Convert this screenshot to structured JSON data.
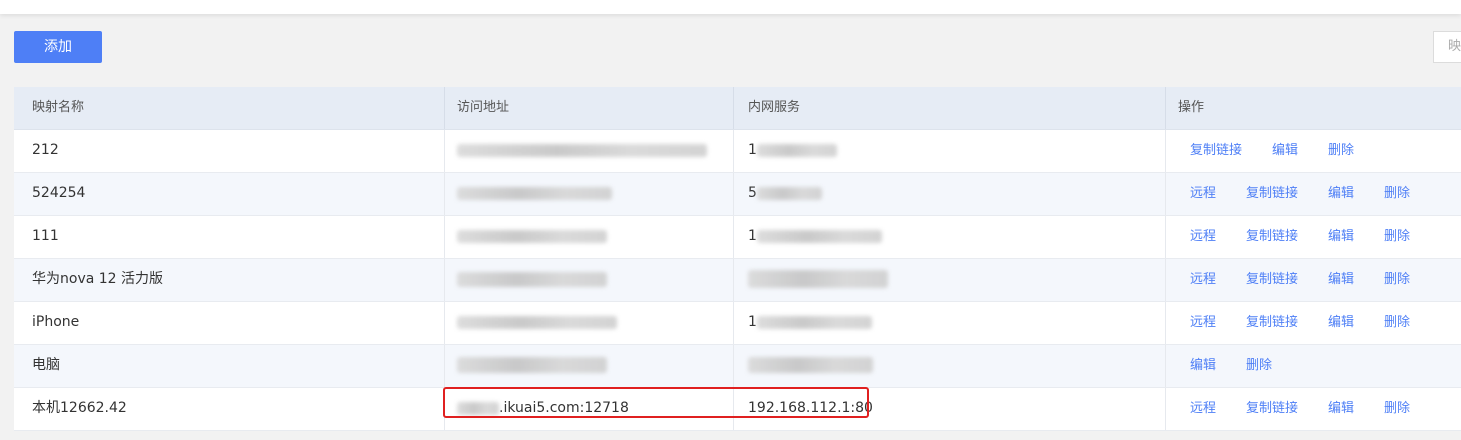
{
  "toolbar": {
    "add_label": "添加",
    "search_placeholder": "映"
  },
  "table": {
    "headers": [
      "映射名称",
      "访问地址",
      "内网服务",
      "操作"
    ],
    "rows": [
      {
        "name": "212",
        "address": "",
        "service": "1",
        "actions": [
          "复制链接",
          "编辑",
          "删除"
        ]
      },
      {
        "name": "524254",
        "address": "",
        "service": "5",
        "actions": [
          "远程",
          "复制链接",
          "编辑",
          "删除"
        ]
      },
      {
        "name": "111",
        "address": "",
        "service": "1",
        "actions": [
          "远程",
          "复制链接",
          "编辑",
          "删除"
        ]
      },
      {
        "name": "华为nova 12 活力版",
        "address": "",
        "service": "",
        "actions": [
          "远程",
          "复制链接",
          "编辑",
          "删除"
        ]
      },
      {
        "name": "iPhone",
        "address": "",
        "service": "1",
        "actions": [
          "远程",
          "复制链接",
          "编辑",
          "删除"
        ]
      },
      {
        "name": "电脑",
        "address": "",
        "service": "",
        "actions": [
          "编辑",
          "删除"
        ]
      },
      {
        "name": "本机12662.42",
        "address": ".ikuai5.com:12718",
        "service": "192.168.112.1:80",
        "actions": [
          "远程",
          "复制链接",
          "编辑",
          "删除"
        ]
      }
    ]
  },
  "colors": {
    "accent": "#4e7ff6",
    "highlight": "#e02020",
    "header_bg": "#e6ecf5",
    "alt_row_bg": "#f4f7fc"
  }
}
